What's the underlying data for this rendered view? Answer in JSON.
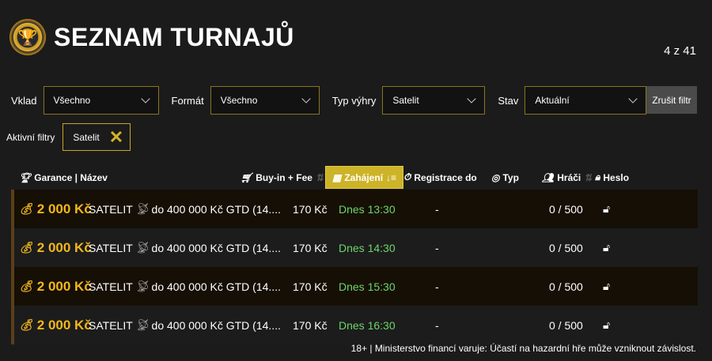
{
  "header": {
    "title": "SEZNAM TURNAJŮ",
    "count": "4 z 41",
    "logo_icon": "trophy-chip-icon"
  },
  "filters": [
    {
      "label": "Vklad",
      "value": "Všechno"
    },
    {
      "label": "Formát",
      "value": "Všechno"
    },
    {
      "label": "Typ výhry",
      "value": "Satelit"
    },
    {
      "label": "Stav",
      "value": "Aktuální"
    }
  ],
  "clear_label": "Zrušit filtr",
  "active_filters": {
    "label": "Aktivní filtry",
    "tags": [
      "Satelit"
    ]
  },
  "columns": {
    "name": "Garance | Název",
    "buyin": "Buy-in + Fee",
    "start": "Zahájení",
    "reg": "Registrace do",
    "type": "Typ",
    "players": "Hráči",
    "password": "Heslo"
  },
  "rows": [
    {
      "guarantee": "2 000 Kč",
      "name_prefix": "SATELIT",
      "name": "do 400 000 Kč GTD (14....",
      "buyin": "170 Kč",
      "start": "Dnes 13:30",
      "reg": "-",
      "players": "0 / 500"
    },
    {
      "guarantee": "2 000 Kč",
      "name_prefix": "SATELIT",
      "name": "do 400 000 Kč GTD (14....",
      "buyin": "170 Kč",
      "start": "Dnes 14:30",
      "reg": "-",
      "players": "0 / 500"
    },
    {
      "guarantee": "2 000 Kč",
      "name_prefix": "SATELIT",
      "name": "do 400 000 Kč GTD (14....",
      "buyin": "170 Kč",
      "start": "Dnes 15:30",
      "reg": "-",
      "players": "0 / 500"
    },
    {
      "guarantee": "2 000 Kč",
      "name_prefix": "SATELIT",
      "name": "do 400 000 Kč GTD (14....",
      "buyin": "170 Kč",
      "start": "Dnes 16:30",
      "reg": "-",
      "players": "0 / 500"
    }
  ],
  "footer": "18+ | Ministerstvo financí varuje: Účastí na hazardní hře může vzniknout závislost.",
  "colors": {
    "accent": "#cdb327",
    "guarantee": "#f2b71c",
    "start_time": "#6bd66b"
  }
}
